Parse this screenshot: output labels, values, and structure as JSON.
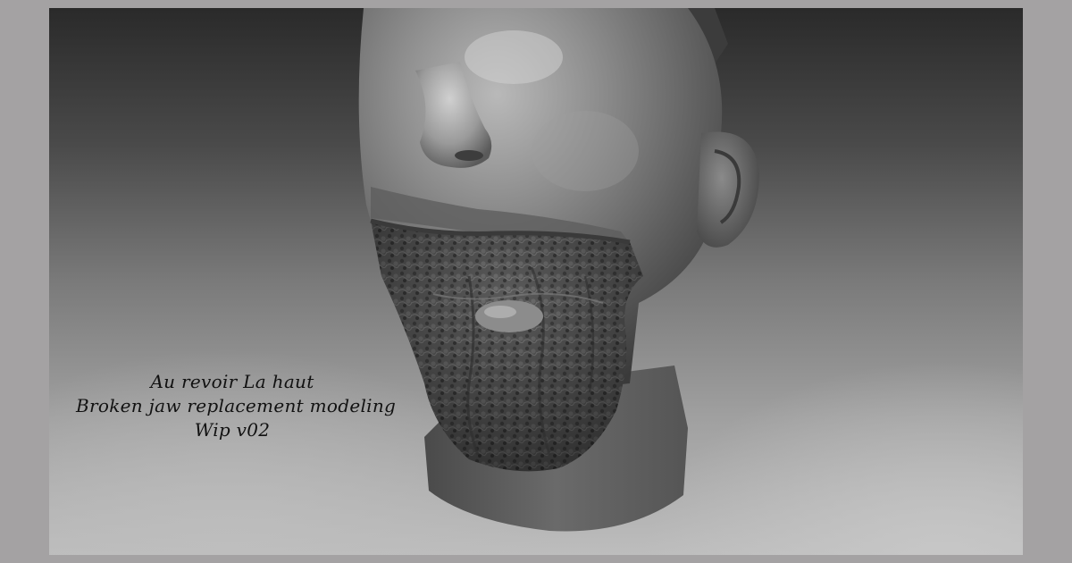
{
  "image": {
    "subject": "zbrush-style grey clay sculpt of a head with a broken, shattered jaw, floating against a dark-to-light grey gradient",
    "colors": {
      "outer_border": "#a4a2a3",
      "background_dark": "#2a2a2a",
      "background_light": "#bdbdbd",
      "clay_base": "#6f6f6f",
      "clay_highlight": "#c8c8c8",
      "clay_shadow": "#2f2f2f",
      "caption_text": "#111111"
    }
  },
  "caption": {
    "line1": "Au revoir La haut",
    "line2": "Broken jaw replacement modeling",
    "line3": "Wip v02"
  }
}
